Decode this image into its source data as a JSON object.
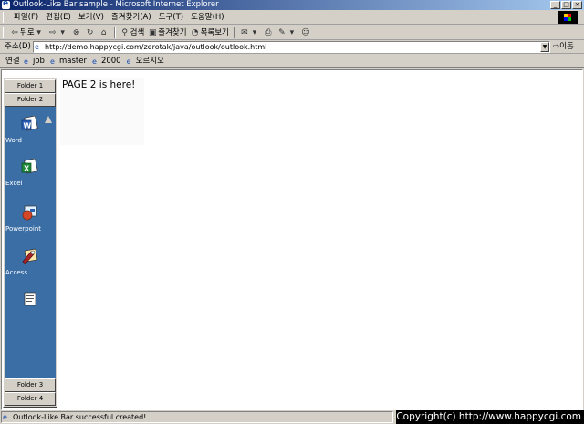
{
  "window": {
    "title": "Outlook-Like Bar sample - Microsoft Internet Explorer",
    "controls": [
      "_",
      "□",
      "×"
    ]
  },
  "menu": {
    "items": [
      "파일(F)",
      "편집(E)",
      "보기(V)",
      "즐겨찾기(A)",
      "도구(T)",
      "도움말(H)"
    ]
  },
  "toolbar": {
    "back_label": "뒤로",
    "search_label": "검색",
    "favorites_label": "즐겨찾기",
    "history_label": "목록보기"
  },
  "address": {
    "label": "주소(D)",
    "url": "http://demo.happycgi.com/zerotak/java/outlook/outlook.html",
    "go_label": "이동"
  },
  "links": {
    "label": "연결",
    "items": [
      "job",
      "master",
      "2000",
      "오르지오"
    ]
  },
  "outlook_bar": {
    "folders_top": [
      "Folder 1",
      "Folder 2"
    ],
    "folders_bottom": [
      "Folder 3",
      "Folder 4"
    ],
    "items": [
      {
        "label": "Word",
        "icon": "word-icon"
      },
      {
        "label": "Excel",
        "icon": "excel-icon"
      },
      {
        "label": "Powerpoint",
        "icon": "powerpoint-icon"
      },
      {
        "label": "Access",
        "icon": "access-icon"
      }
    ],
    "panel_color": "#3a6ea5"
  },
  "page": {
    "text": "PAGE 2 is here!"
  },
  "status": {
    "text": "Outlook-Like Bar successful created!",
    "copyright": "Copyright(c) http://www.happycgi.com"
  }
}
